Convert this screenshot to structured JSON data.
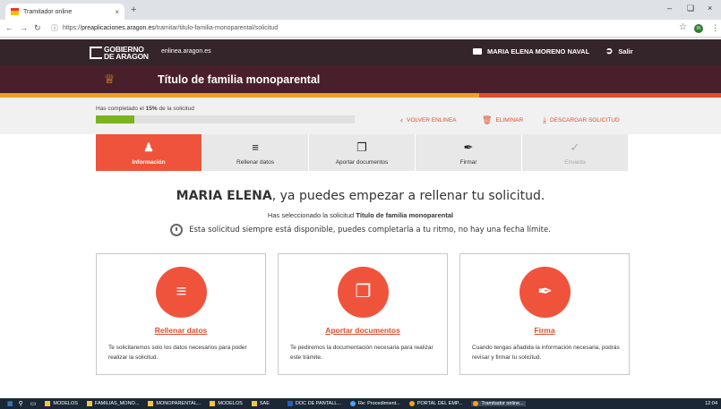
{
  "browser": {
    "tab_title": "Tramitador online",
    "tab_close": "×",
    "new_tab": "+",
    "url_prefix": "https://",
    "url_domain": "preaplicaciones.aragon.es",
    "url_path": "/tramitar/titulo-familia-monoparental/solicitud",
    "profile_initial": "m"
  },
  "site": {
    "logo_line1": "GOBIERNO",
    "logo_line2": "DE ARAGON",
    "site_link": "enlinea.aragon.es",
    "user_name": "MARIA ELENA MORENO NAVAL",
    "logout": "Salir"
  },
  "page": {
    "title": "Título de familia monoparental",
    "progress_prefix": "Has completado el ",
    "progress_percent": "15%",
    "progress_suffix": " de la solicitud",
    "progress_value": 0.15,
    "actions": {
      "back": "VOLVER ENLINEA",
      "delete": "ELIMINAR",
      "download": "DESCARGAR SOLICITUD"
    }
  },
  "steps": [
    {
      "label": "Información",
      "icon": "person-icon"
    },
    {
      "label": "Rellenar datos",
      "icon": "menu-icon"
    },
    {
      "label": "Aportar documentos",
      "icon": "documents-icon"
    },
    {
      "label": "Firmar",
      "icon": "pen-icon"
    },
    {
      "label": "Enviada",
      "icon": "check-icon"
    }
  ],
  "main": {
    "greeting_name": "MARIA ELENA",
    "greeting_rest": ", ya puedes empezar a rellenar tu solicitud.",
    "selected_prefix": "Has seleccionado la solicitud ",
    "selected_name": "Título de familia monoparental",
    "availability": "Esta solicitud siempre está disponible, puedes completarla a tu ritmo, no hay una fecha límite."
  },
  "cards": [
    {
      "title": "Rellenar datos",
      "desc": "Te solicitaremos solo los datos necesarios para poder realizar la solicitud.",
      "icon": "menu-icon"
    },
    {
      "title": "Aportar documentos",
      "desc": "Te pediremos la documentación necesaria para realizar este trámite.",
      "icon": "documents-icon"
    },
    {
      "title": "Firma",
      "desc": "Cuando tengas añadida la información necesaria, podrás revisar y firmar tu solicitud.",
      "icon": "pen-icon"
    }
  ],
  "taskbar": {
    "items": [
      "MODELOS",
      "FAMILIAS_MONO...",
      "MONOPARENTAL...",
      "MODELOS",
      "SAE",
      "DOC DE PANTALL...",
      "Re: Procedimient...",
      "PORTAL DEL EMP...",
      "Tramitador online..."
    ],
    "clock": "12:04"
  },
  "colors": {
    "accent": "#f0533c",
    "header": "#34252b",
    "title_band": "#4a1f2c",
    "progress": "#7ab41f"
  }
}
